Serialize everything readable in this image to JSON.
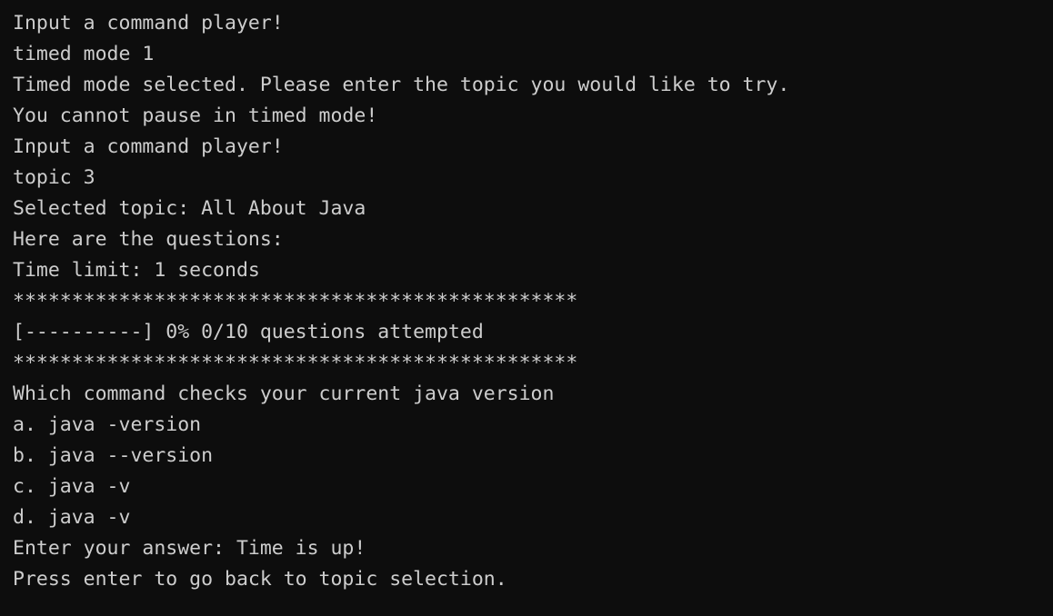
{
  "terminal": {
    "title": "java-quiz-console",
    "colors": {
      "background": "#0d0d0d",
      "foreground": "#cdcdcd"
    },
    "session": {
      "mode": "timed",
      "mode_code": "1",
      "topic_number": "3",
      "topic_name": "All About Java",
      "time_limit_seconds": "1",
      "progress_percent": "0%",
      "questions_attempted": "0/10",
      "separator": "************************************************",
      "progress_bar": "[----------]"
    },
    "question": {
      "prompt": "Which command checks your current java version",
      "options": [
        "a. java -version",
        "b. java --version",
        "c. java -v",
        "d. java -v"
      ],
      "answer_prompt": "Enter your answer:",
      "timeout_message": "Time is up!"
    },
    "lines": [
      "Input a command player!",
      "timed mode 1",
      "Timed mode selected. Please enter the topic you would like to try.",
      "You cannot pause in timed mode!",
      "Input a command player!",
      "topic 3",
      "Selected topic: All About Java",
      "Here are the questions:",
      "Time limit: 1 seconds",
      "************************************************",
      "[----------] 0% 0/10 questions attempted",
      "************************************************",
      "Which command checks your current java version",
      "a. java -version",
      "b. java --version",
      "c. java -v",
      "d. java -v",
      "Enter your answer: Time is up!",
      "Press enter to go back to topic selection."
    ]
  }
}
